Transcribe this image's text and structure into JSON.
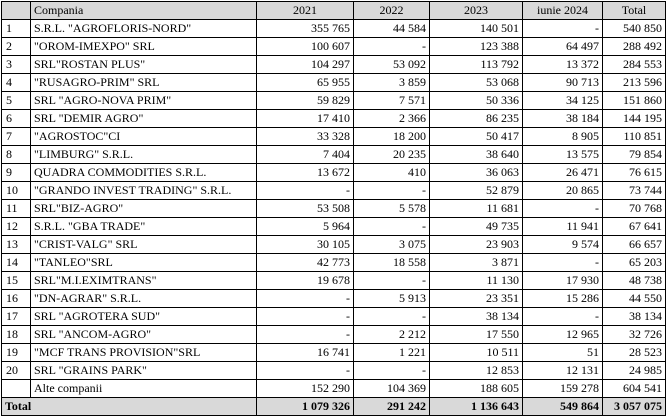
{
  "table": {
    "headers": [
      "",
      "Compania",
      "2021",
      "2022",
      "2023",
      "iunie 2024",
      "Total"
    ],
    "rows": [
      [
        "1",
        "S.R.L. \"AGROFLORIS-NORD\"",
        "355 765",
        "44 584",
        "140 501",
        "-",
        "540 850"
      ],
      [
        "2",
        "\"OROM-IMEXPO\" SRL",
        "100 607",
        "-",
        "123 388",
        "64 497",
        "288 492"
      ],
      [
        "3",
        "SRL\"ROSTAN PLUS\"",
        "104 297",
        "53 092",
        "113 792",
        "13 372",
        "284 553"
      ],
      [
        "4",
        "\"RUSAGRO-PRIM\" SRL",
        "65 955",
        "3 859",
        "53 068",
        "90 713",
        "213 596"
      ],
      [
        "5",
        "SRL \"AGRO-NOVA PRIM\"",
        "59 829",
        "7 571",
        "50 336",
        "34 125",
        "151 860"
      ],
      [
        "6",
        "SRL \"DEMIR AGRO\"",
        "17 410",
        "2 366",
        "86 235",
        "38 184",
        "144 195"
      ],
      [
        "7",
        "\"AGROSTOC\"CI",
        "33 328",
        "18 200",
        "50 417",
        "8 905",
        "110 851"
      ],
      [
        "8",
        "\"LIMBURG\" S.R.L.",
        "7 404",
        "20 235",
        "38 640",
        "13 575",
        "79 854"
      ],
      [
        "9",
        "QUADRA COMMODITIES S.R.L.",
        "13 672",
        "410",
        "36 063",
        "26 471",
        "76 615"
      ],
      [
        "10",
        "\"GRANDO INVEST TRADING\" S.R.L.",
        "-",
        "-",
        "52 879",
        "20 865",
        "73 744"
      ],
      [
        "11",
        "SRL\"BIZ-AGRO\"",
        "53 508",
        "5 578",
        "11 681",
        "-",
        "70 768"
      ],
      [
        "12",
        "S.R.L. \"GBA TRADE\"",
        "5 964",
        "-",
        "49 735",
        "11 941",
        "67 641"
      ],
      [
        "13",
        "\"CRIST-VALG\" SRL",
        "30 105",
        "3 075",
        "23 903",
        "9 574",
        "66 657"
      ],
      [
        "14",
        "\"TANLEO\"SRL",
        "42 773",
        "18 558",
        "3 871",
        "-",
        "65 203"
      ],
      [
        "15",
        "SRL\"M.I.EXIMTRANS\"",
        "19 678",
        "-",
        "11 130",
        "17 930",
        "48 738"
      ],
      [
        "16",
        "\"DN-AGRAR\" S.R.L.",
        "-",
        "5 913",
        "23 351",
        "15 286",
        "44 550"
      ],
      [
        "17",
        "SRL \"AGROTERA SUD\"",
        "-",
        "-",
        "38 134",
        "-",
        "38 134"
      ],
      [
        "18",
        "SRL \"ANCOM-AGRO\"",
        "-",
        "2 212",
        "17 550",
        "12 965",
        "32 726"
      ],
      [
        "19",
        "\"MCF TRANS PROVISION\"SRL",
        "16 741",
        "1 221",
        "10 511",
        "51",
        "28 523"
      ],
      [
        "20",
        "SRL \"GRAINS PARK\"",
        "-",
        "-",
        "12 853",
        "12 131",
        "24 985"
      ],
      [
        "",
        "Alte companii",
        "152 290",
        "104 369",
        "188 605",
        "159 278",
        "604 541"
      ]
    ],
    "total_row": [
      "Total",
      "",
      "1 079 326",
      "291 242",
      "1 136 643",
      "549 864",
      "3 057 075"
    ]
  }
}
